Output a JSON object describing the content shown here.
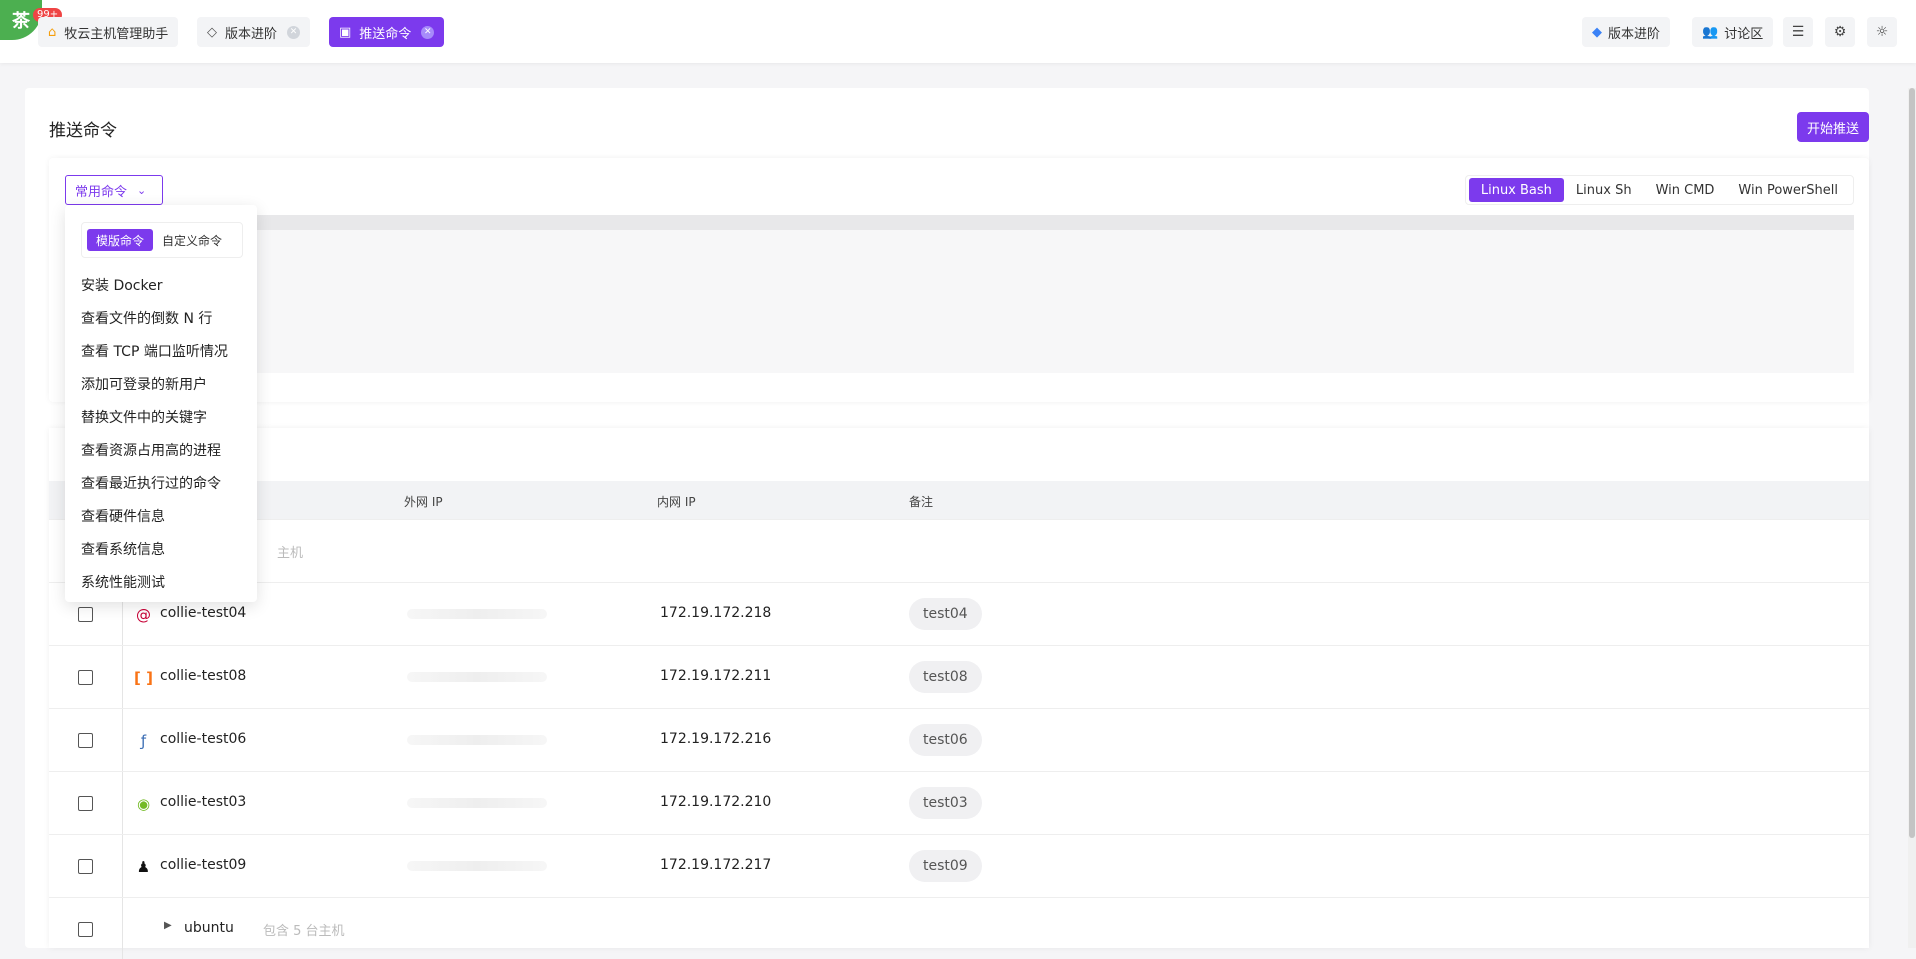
{
  "brand": {
    "logo_glyph": "茶",
    "notification_count": "99+"
  },
  "tabs": [
    {
      "label": "牧云主机管理助手",
      "icon": "home-icon",
      "closable": false,
      "active": false
    },
    {
      "label": "版本进阶",
      "icon": "diamond-icon",
      "closable": true,
      "active": false
    },
    {
      "label": "推送命令",
      "icon": "terminal-icon",
      "closable": true,
      "active": true
    }
  ],
  "header_actions": {
    "upgrade_label": "版本进阶",
    "forum_label": "讨论区"
  },
  "page": {
    "title": "推送命令",
    "start_button": "开始推送"
  },
  "editor": {
    "command_select_label": "常用命令",
    "shells": [
      "Linux Bash",
      "Linux Sh",
      "Win CMD",
      "Win PowerShell"
    ],
    "selected_shell": "Linux Bash"
  },
  "dropdown": {
    "tabs": [
      "模版命令",
      "自定义命令"
    ],
    "active_tab": "模版命令",
    "items": [
      "安装 Docker",
      "查看文件的倒数 N 行",
      "查看 TCP 端口监听情况",
      "添加可登录的新用户",
      "替换文件中的关键字",
      "查看资源占用高的进程",
      "查看最近执行过的命令",
      "查看硬件信息",
      "查看系统信息",
      "系统性能测试"
    ]
  },
  "table": {
    "columns": {
      "public_ip": "外网 IP",
      "private_ip": "内网 IP",
      "note": "备注"
    },
    "group_row_fragment": "主机",
    "rows": [
      {
        "name": "collie-test04",
        "os_icon": "debian-icon",
        "private_ip": "172.19.172.218",
        "note": "test04"
      },
      {
        "name": "collie-test08",
        "os_icon": "aliyun-icon",
        "private_ip": "172.19.172.211",
        "note": "test08"
      },
      {
        "name": "collie-test06",
        "os_icon": "fedora-icon",
        "private_ip": "172.19.172.216",
        "note": "test06"
      },
      {
        "name": "collie-test03",
        "os_icon": "opensuse-icon",
        "private_ip": "172.19.172.210",
        "note": "test03"
      },
      {
        "name": "collie-test09",
        "os_icon": "linux-tux-icon",
        "private_ip": "172.19.172.217",
        "note": "test09"
      }
    ],
    "group_bottom": {
      "name": "ubuntu",
      "sub": "包含 5 台主机"
    }
  },
  "colors": {
    "accent": "#7c3aed",
    "brand_green": "#4caf50"
  }
}
